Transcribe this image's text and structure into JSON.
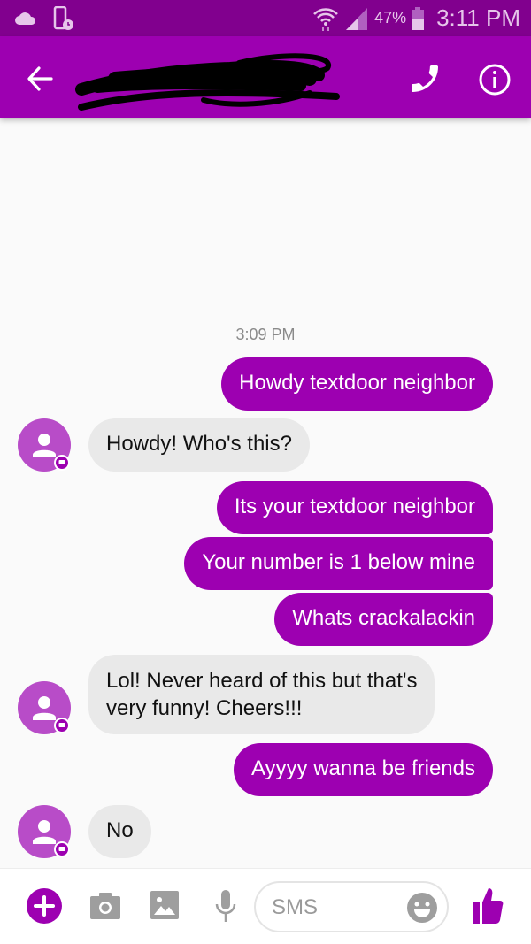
{
  "status_bar": {
    "battery_percent": "47%",
    "time": "3:11 PM",
    "icons": [
      "cloud-icon",
      "phone-clock-icon",
      "wifi-icon",
      "signal-icon",
      "battery-icon"
    ]
  },
  "app_bar": {
    "contact_name": "[redacted]",
    "icons": [
      "back-arrow-icon",
      "phone-icon",
      "info-icon"
    ]
  },
  "conversation": {
    "timestamp": "3:09 PM",
    "messages": [
      {
        "direction": "outgoing",
        "text": "Howdy textdoor neighbor"
      },
      {
        "direction": "incoming",
        "text": "Howdy! Who's this?"
      },
      {
        "direction": "outgoing",
        "text": "Its your textdoor neighbor"
      },
      {
        "direction": "outgoing",
        "text": "Your number is 1 below mine"
      },
      {
        "direction": "outgoing",
        "text": "Whats crackalackin"
      },
      {
        "direction": "incoming",
        "text": "Lol! Never heard of this but that's",
        "text_line2": "very funny! Cheers!!!"
      },
      {
        "direction": "outgoing",
        "text": "Ayyyy wanna be friends"
      },
      {
        "direction": "incoming",
        "text": "No"
      }
    ]
  },
  "composer": {
    "placeholder": "SMS",
    "value": "",
    "icons": [
      "add-icon",
      "camera-icon",
      "gallery-icon",
      "microphone-icon",
      "emoji-icon",
      "thumbs-up-icon"
    ]
  },
  "colors": {
    "status_bar": "#81008e",
    "app_bar": "#9d00b1",
    "outgoing_bubble": "#9d00b1",
    "incoming_bubble": "#e9e9e9",
    "avatar": "#b84cc8",
    "background": "#fafafa"
  }
}
